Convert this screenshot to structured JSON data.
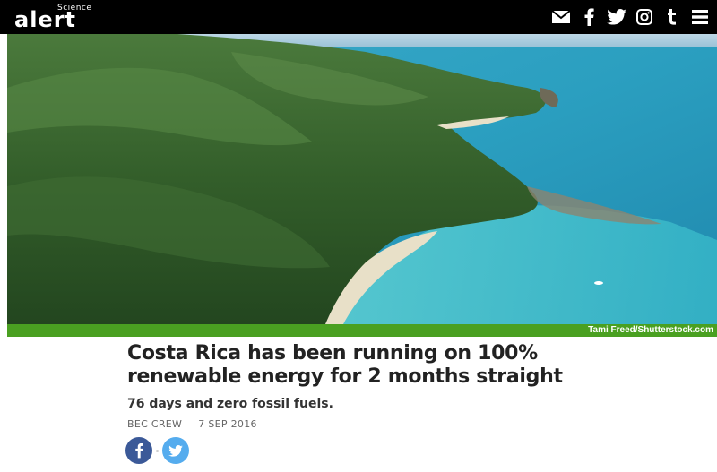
{
  "header": {
    "logo_small": "Science",
    "logo_big": "alert",
    "social_icons": [
      "mail-icon",
      "facebook-icon",
      "twitter-icon",
      "instagram-icon",
      "tumblr-icon",
      "menu-icon"
    ]
  },
  "hero": {
    "credit": "Tami Freed/Shutterstock.com"
  },
  "article": {
    "headline": "Costa Rica has been running on 100% renewable energy for 2 months straight",
    "subhead": "76 days and zero fossil fuels.",
    "author": "BEC CREW",
    "date": "7 SEP 2016"
  },
  "share": {
    "facebook_icon": "f",
    "twitter_icon": "twitter-bird"
  },
  "colors": {
    "topbar": "#000000",
    "accent_green": "#4aa021",
    "facebook": "#3b5998",
    "twitter": "#55acee"
  }
}
